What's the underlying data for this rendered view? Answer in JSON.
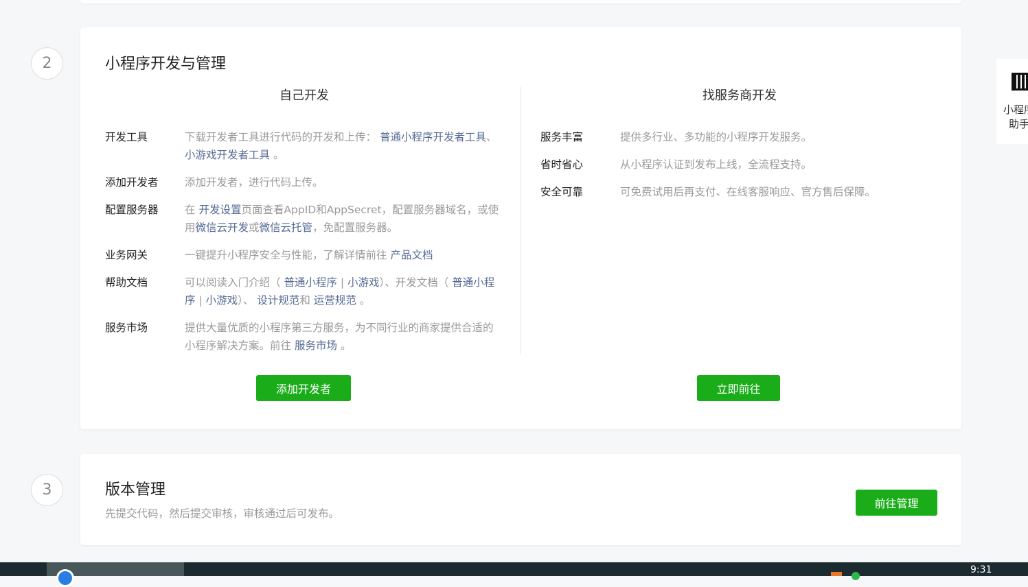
{
  "section2": {
    "step": "2",
    "title": "小程序开发与管理",
    "left": {
      "heading": "自己开发",
      "rows": [
        {
          "label": "开发工具",
          "segments": [
            {
              "t": "下载开发者工具进行代码的开发和上传： "
            },
            {
              "t": "普通小程序开发者工具",
              "link": true
            },
            {
              "t": "、 "
            },
            {
              "t": "小游戏开发者工具",
              "link": true
            },
            {
              "t": " 。"
            }
          ]
        },
        {
          "label": "添加开发者",
          "segments": [
            {
              "t": "添加开发者，进行代码上传。"
            }
          ]
        },
        {
          "label": "配置服务器",
          "segments": [
            {
              "t": "在 "
            },
            {
              "t": "开发设置",
              "link": true
            },
            {
              "t": "页面查看AppID和AppSecret，配置服务器域名，或使用"
            },
            {
              "t": "微信云开发",
              "link": true
            },
            {
              "t": "或"
            },
            {
              "t": "微信云托管",
              "link": true
            },
            {
              "t": "，免配置服务器。"
            }
          ]
        },
        {
          "label": "业务网关",
          "segments": [
            {
              "t": "一键提升小程序安全与性能，了解详情前往 "
            },
            {
              "t": "产品文档",
              "link": true
            }
          ]
        },
        {
          "label": "帮助文档",
          "segments": [
            {
              "t": "可以阅读入门介绍（ "
            },
            {
              "t": "普通小程序",
              "link": true
            },
            {
              "t": " | "
            },
            {
              "t": "小游戏",
              "link": true
            },
            {
              "t": "）、开发文档（ "
            },
            {
              "t": "普通小程序",
              "link": true
            },
            {
              "t": " | "
            },
            {
              "t": "小游戏",
              "link": true
            },
            {
              "t": "）、 "
            },
            {
              "t": "设计规范",
              "link": true
            },
            {
              "t": "和 "
            },
            {
              "t": "运营规范",
              "link": true
            },
            {
              "t": " 。"
            }
          ]
        },
        {
          "label": "服务市场",
          "segments": [
            {
              "t": "提供大量优质的小程序第三方服务，为不同行业的商家提供合适的小程序解决方案。前往 "
            },
            {
              "t": "服务市场",
              "link": true
            },
            {
              "t": " 。"
            }
          ]
        }
      ],
      "button": "添加开发者"
    },
    "right": {
      "heading": "找服务商开发",
      "rows": [
        {
          "label": "服务丰富",
          "segments": [
            {
              "t": "提供多行业、多功能的小程序开发服务。"
            }
          ]
        },
        {
          "label": "省时省心",
          "segments": [
            {
              "t": "从小程序认证到发布上线，全流程支持。"
            }
          ]
        },
        {
          "label": "安全可靠",
          "segments": [
            {
              "t": "可免费试用后再支付、在线客服响应、官方售后保障。"
            }
          ]
        }
      ],
      "button": "立即前往"
    }
  },
  "section3": {
    "step": "3",
    "title": "版本管理",
    "desc": "先提交代码，然后提交审核，审核通过后可发布。",
    "button": "前往管理"
  },
  "side": {
    "line1": "小程序",
    "line2": "助手",
    "icon": "qr-code-icon"
  },
  "taskbar": {
    "time": "9:31"
  },
  "colors": {
    "accent": "#1aad19",
    "link": "#576b95"
  }
}
